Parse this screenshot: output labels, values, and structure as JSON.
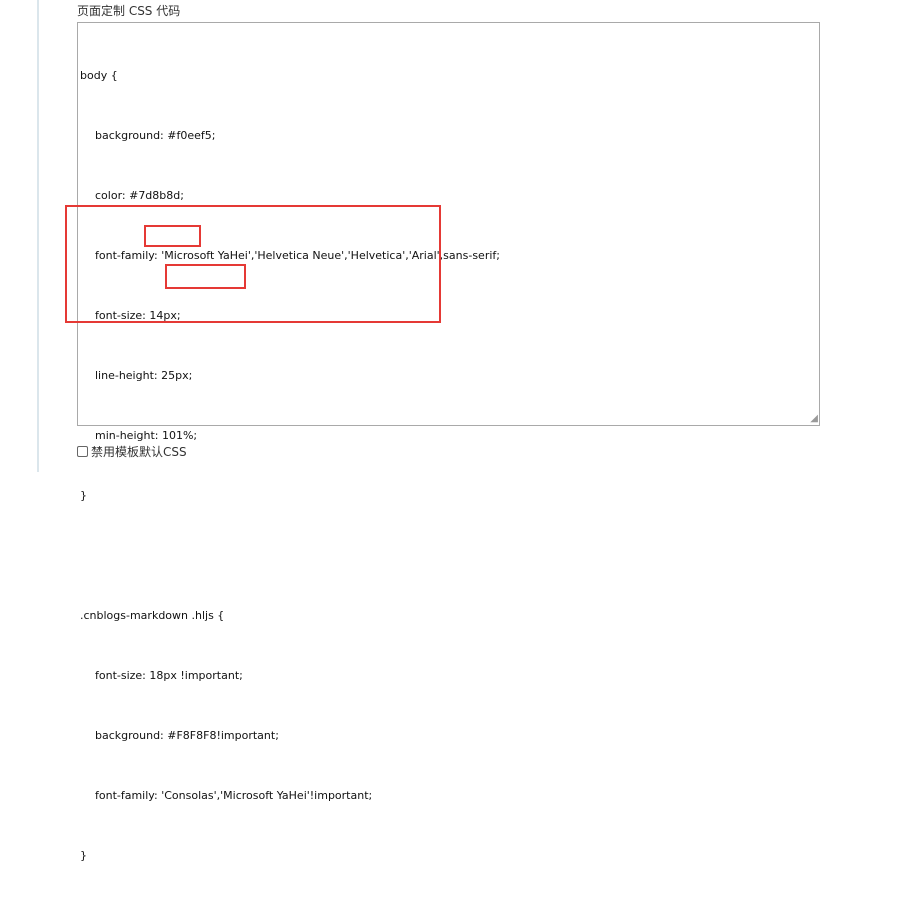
{
  "section_title": "页面定制 CSS 代码",
  "code_lines": [
    "body {",
    "background: #f0eef5;",
    "color: #7d8b8d;",
    "font-family: 'Microsoft YaHei','Helvetica Neue','Helvetica','Arial',sans-serif;",
    "font-size: 14px;",
    "line-height: 25px;",
    "min-height: 101%;",
    "}",
    "",
    ".cnblogs-markdown .hljs {",
    "font-size: 18px !important;",
    "background: #F8F8F8!important;",
    "font-family: 'Consolas','Microsoft YaHei'!important;",
    "}"
  ],
  "checkbox": {
    "label": "禁用模板默认CSS",
    "checked": false
  },
  "colors": {
    "highlight": "#e53935"
  }
}
